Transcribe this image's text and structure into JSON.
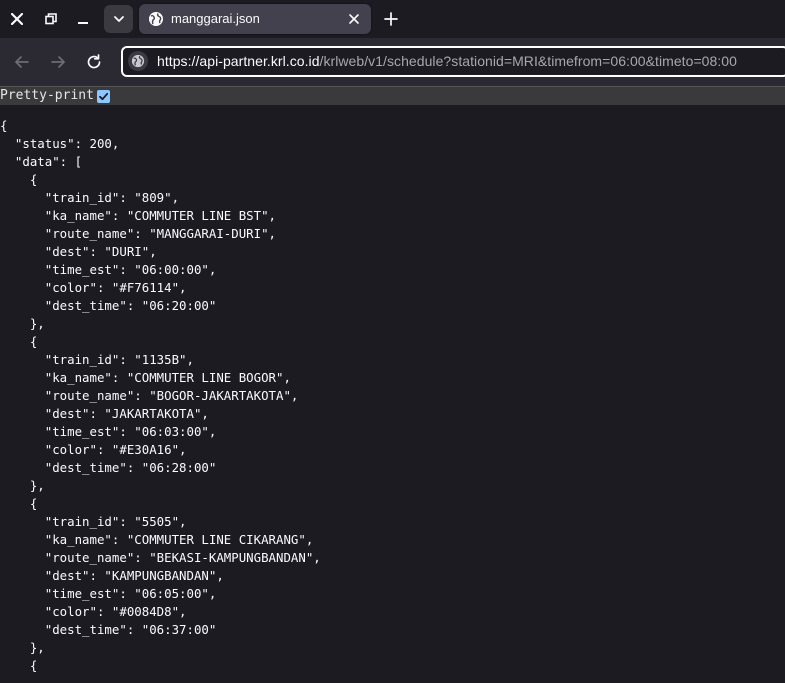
{
  "browser": {
    "tab_title": "manggarai.json",
    "url_host": "https://api-partner.krl.co.id",
    "url_path": "/krlweb/v1/schedule?stationid=MRI&timefrom=06:00&timeto=08:00"
  },
  "viewer": {
    "pretty_print_label": "Pretty-print",
    "pretty_print_checked": true
  },
  "json_lines": [
    "{",
    "  \"status\": 200,",
    "  \"data\": [",
    "    {",
    "      \"train_id\": \"809\",",
    "      \"ka_name\": \"COMMUTER LINE BST\",",
    "      \"route_name\": \"MANGGARAI-DURI\",",
    "      \"dest\": \"DURI\",",
    "      \"time_est\": \"06:00:00\",",
    "      \"color\": \"#F76114\",",
    "      \"dest_time\": \"06:20:00\"",
    "    },",
    "    {",
    "      \"train_id\": \"1135B\",",
    "      \"ka_name\": \"COMMUTER LINE BOGOR\",",
    "      \"route_name\": \"BOGOR-JAKARTAKOTA\",",
    "      \"dest\": \"JAKARTAKOTA\",",
    "      \"time_est\": \"06:03:00\",",
    "      \"color\": \"#E30A16\",",
    "      \"dest_time\": \"06:28:00\"",
    "    },",
    "    {",
    "      \"train_id\": \"5505\",",
    "      \"ka_name\": \"COMMUTER LINE CIKARANG\",",
    "      \"route_name\": \"BEKASI-KAMPUNGBANDAN\",",
    "      \"dest\": \"KAMPUNGBANDAN\",",
    "      \"time_est\": \"06:05:00\",",
    "      \"color\": \"#0084D8\",",
    "      \"dest_time\": \"06:37:00\"",
    "    },",
    "    {"
  ],
  "colors": {
    "tabstrip_bg": "#1c1b22",
    "toolbar_bg": "#2b2a33",
    "active_tab_bg": "#42414d",
    "page_bg": "#1c1b22",
    "checkbox_accent": "#8cc8ff"
  }
}
